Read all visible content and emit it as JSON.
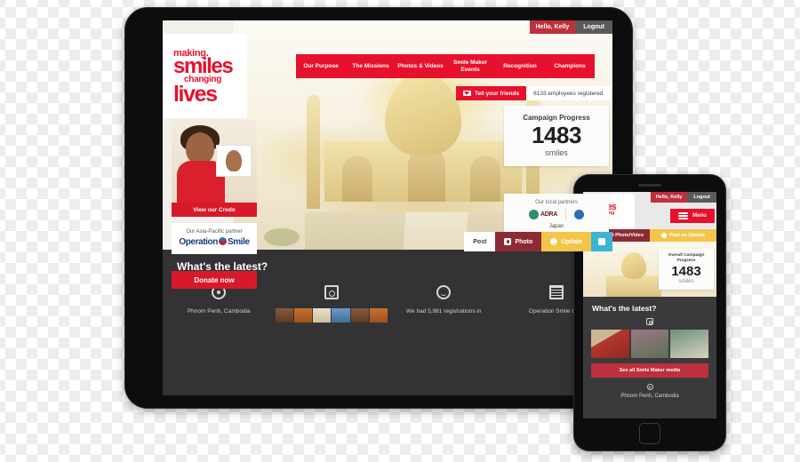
{
  "brand": {
    "primary_red": "#e8112d",
    "dark_red": "#8c2b33",
    "gold": "#f3c54b",
    "cyan": "#3bb4d6",
    "logo_line1": "making.",
    "logo_line2": "smiles",
    "logo_line3": "changing",
    "logo_line4": "lives"
  },
  "tablet": {
    "userbar": {
      "hello": "Hello, Kelly",
      "logout": "Logout"
    },
    "nav": [
      {
        "label": "Our Purpose"
      },
      {
        "label": "The Missions"
      },
      {
        "label": "Photos & Videos"
      },
      {
        "label": "Smile Maker Events"
      },
      {
        "label": "Recognition"
      },
      {
        "label": "Champions"
      }
    ],
    "tell": {
      "button": "Tell your friends",
      "count": "6133 employees registered"
    },
    "progress": {
      "title": "Campaign Progress",
      "number": "1483",
      "unit": "smiles"
    },
    "partners": {
      "title": "Our local partners",
      "logo": "ADRA",
      "country": "Japan"
    },
    "credo_button": "View our Credo",
    "apac": {
      "title": "Our Asia-Pacific partner",
      "logo_left": "Operation",
      "logo_right": "Smile"
    },
    "donate_button": "Donate now",
    "actions": [
      {
        "label": "Post",
        "icon": "none"
      },
      {
        "label": "Photo",
        "icon": "camera-icon"
      },
      {
        "label": "Update",
        "icon": "smiley-icon"
      },
      {
        "label": "",
        "icon": "calendar-icon"
      }
    ],
    "feed": {
      "heading": "What's the latest?",
      "items": [
        {
          "icon": "location-icon",
          "text": "Phnom Penh, Cambodia"
        },
        {
          "icon": "camera-icon",
          "text": ""
        },
        {
          "icon": "smiley-icon",
          "text": "We had 5,981 registrations in"
        },
        {
          "icon": "calendar-icon",
          "text": "Operation Smile Offic"
        }
      ]
    }
  },
  "phone": {
    "userbar": {
      "hello": "Hello, Kelly",
      "logout": "Logout"
    },
    "menu_label": "Menu",
    "actions": [
      {
        "label": "Upload Photo/Video",
        "icon": "camera-icon"
      },
      {
        "label": "Post an Update",
        "icon": "smiley-icon"
      }
    ],
    "progress": {
      "title": "Overall Campaign Progress",
      "number": "1483",
      "unit": "smiles"
    },
    "feed": {
      "heading": "What's the latest?",
      "media_button": "See all Smile Maker media",
      "location": "Phnom Penh, Cambodia"
    }
  }
}
